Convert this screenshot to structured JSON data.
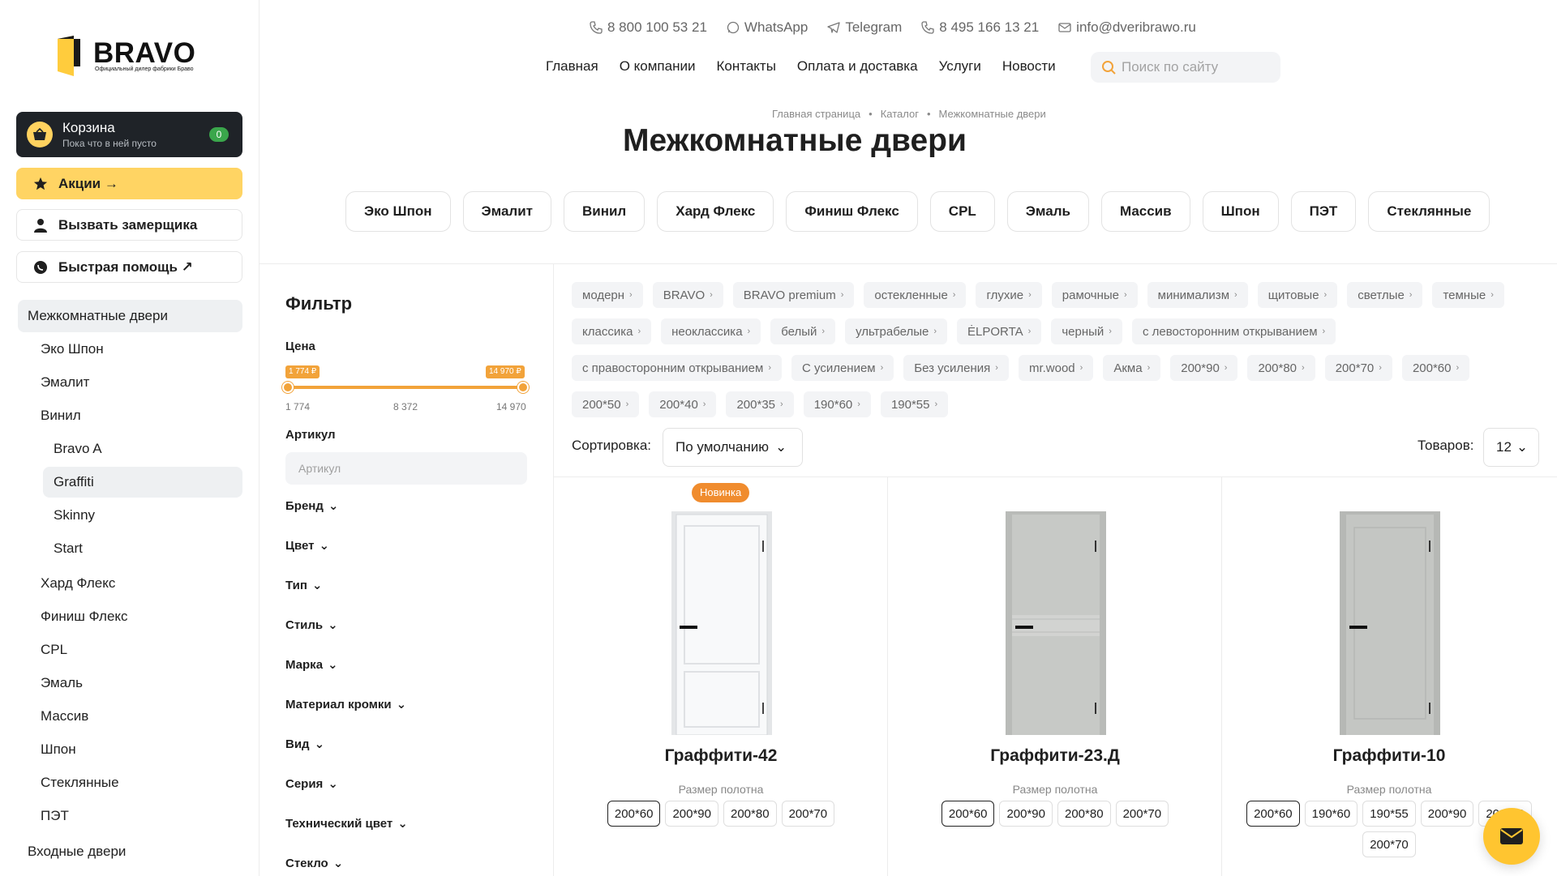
{
  "brand": {
    "name": "BRAVO",
    "tagline": "Официальный дилер фабрики Браво"
  },
  "cart": {
    "title": "Корзина",
    "subtitle": "Пока что в ней пусто",
    "count": "0"
  },
  "sidebar_buttons": {
    "promo": "Акции →",
    "measure": "Вызвать замерщика",
    "help": "Быстрая помощь ↗"
  },
  "sidebar_nav": {
    "main": "Межкомнатные двери",
    "items": [
      "Эко Шпон",
      "Эмалит",
      "Винил"
    ],
    "vinyl_sub": [
      "Bravo A",
      "Graffiti",
      "Skinny",
      "Start"
    ],
    "items2": [
      "Хард Флекс",
      "Финиш Флекс",
      "CPL",
      "Эмаль",
      "Массив",
      "Шпон",
      "Стеклянные",
      "ПЭТ"
    ],
    "entrance": "Входные двери"
  },
  "contacts": {
    "phone1": "8 800 100 53 21",
    "whatsapp": "WhatsApp",
    "telegram": "Telegram",
    "phone2": "8 495 166 13 21",
    "email": "info@dveribrawo.ru"
  },
  "topnav": [
    "Главная",
    "О компании",
    "Контакты",
    "Оплата и доставка",
    "Услуги",
    "Новости"
  ],
  "search": {
    "placeholder": "Поиск по сайту"
  },
  "breadcrumb": [
    "Главная страница",
    "•",
    "Каталог",
    "•",
    "Межкомнатные двери"
  ],
  "page_title": "Межкомнатные двери",
  "categories": [
    "Эко Шпон",
    "Эмалит",
    "Винил",
    "Хард Флекс",
    "Финиш Флекс",
    "CPL",
    "Эмаль",
    "Массив",
    "Шпон",
    "ПЭТ",
    "Стеклянные"
  ],
  "filter": {
    "title": "Фильтр",
    "price_label": "Цена",
    "price_min_tag": "1 774 ₽",
    "price_max_tag": "14 970 ₽",
    "price_min": "1 774",
    "price_mid": "8 372",
    "price_max": "14 970",
    "article_label": "Артикул",
    "article_placeholder": "Артикул",
    "groups": [
      "Бренд",
      "Цвет",
      "Тип",
      "Стиль",
      "Марка",
      "Материал кромки",
      "Вид",
      "Серия",
      "Технический цвет",
      "Стекло"
    ]
  },
  "tags": [
    "модерн",
    "BRAVO",
    "BRAVO premium",
    "остекленные",
    "глухие",
    "рамочные",
    "минимализм",
    "щитовые",
    "светлые",
    "темные",
    "классика",
    "неоклассика",
    "белый",
    "ультрабелые",
    "ĖLPORTA",
    "черный",
    "с левосторонним открыванием",
    "с правосторонним открыванием",
    "С усилением",
    "Без усиления",
    "mr.wood",
    "Акма",
    "200*90",
    "200*80",
    "200*70",
    "200*60",
    "200*50",
    "200*40",
    "200*35",
    "190*60",
    "190*55"
  ],
  "sort": {
    "label": "Сортировка:",
    "value": "По умолчанию"
  },
  "quantity": {
    "label": "Товаров:",
    "value": "12"
  },
  "products": [
    {
      "name": "Граффити-42",
      "badge": "Новинка",
      "size_label": "Размер полотна",
      "sizes": [
        "200*60",
        "200*90",
        "200*80",
        "200*70"
      ],
      "color": "#f4f5f6"
    },
    {
      "name": "Граффити-23.Д",
      "size_label": "Размер полотна",
      "sizes": [
        "200*60",
        "200*90",
        "200*80",
        "200*70"
      ],
      "color": "#c7c9c6"
    },
    {
      "name": "Граффити-10",
      "size_label": "Размер полотна",
      "sizes": [
        "200*60",
        "190*60",
        "190*55",
        "200*90",
        "200*80",
        "200*70"
      ],
      "color": "#c4c6c3"
    }
  ],
  "colors": {
    "accent": "#ffd463",
    "orange": "#f08c2e",
    "dark": "#1f2328",
    "green": "#3aa64b"
  }
}
